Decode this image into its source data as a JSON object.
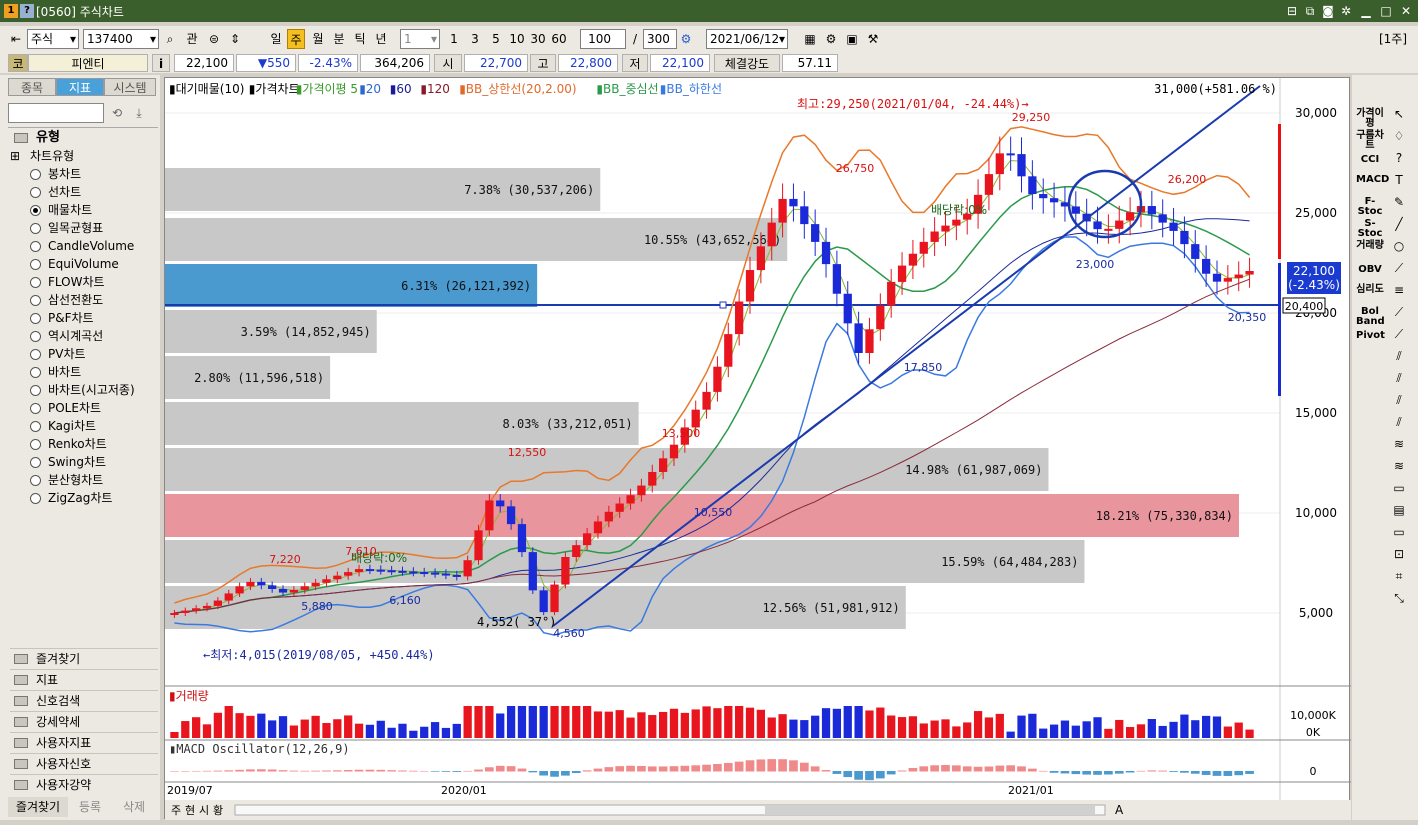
{
  "window": {
    "title": "[0560] 주식차트",
    "badge1": "1",
    "badge2": "?",
    "ctrl_icons": [
      "layout-icon",
      "copy-window-icon",
      "camera-icon",
      "settings-icon",
      "minimize-icon",
      "maximize-icon",
      "close-icon"
    ]
  },
  "toolbar": {
    "market": "주식",
    "code": "137400",
    "gwan": "관",
    "periods": [
      "일",
      "주",
      "월",
      "분",
      "틱",
      "년"
    ],
    "active_period": "주",
    "interval": "1",
    "quick": [
      "1",
      "3",
      "5",
      "10",
      "30",
      "60"
    ],
    "count": "100",
    "slash": "/",
    "total": "300",
    "date": "2021/06/12",
    "period_tag": "[1주]"
  },
  "info": {
    "cat": "코",
    "name": "피엔티",
    "i": "i",
    "price": "22,100",
    "change": "▼550",
    "rate": "-2.43%",
    "volume": "364,206",
    "open_label": "시",
    "open": "22,700",
    "high_label": "고",
    "high": "22,800",
    "low_label": "저",
    "low": "22,100",
    "strength_label": "체결강도",
    "strength": "57.11"
  },
  "sidebar": {
    "tabs": [
      "종목",
      "지표",
      "시스템"
    ],
    "active_tab": "지표",
    "section": "유형",
    "group": "차트유형",
    "types": [
      "봉차트",
      "선차트",
      "매물차트",
      "일목균형표",
      "CandleVolume",
      "EquiVolume",
      "FLOW차트",
      "삼선전환도",
      "P&F차트",
      "역시계곡선",
      "PV차트",
      "바차트",
      "바차트(시고저종)",
      "POLE차트",
      "Kagi차트",
      "Renko차트",
      "Swing차트",
      "분산형차트",
      "ZigZag차트"
    ],
    "selected_type": "매물차트",
    "accordion": [
      "즐겨찾기",
      "지표",
      "신호검색",
      "강세약세",
      "사용자지표",
      "사용자신호",
      "사용자강약"
    ],
    "bottom_tabs": [
      "즐겨찾기",
      "등록",
      "삭제"
    ]
  },
  "chart_legend": {
    "items": [
      "▮대기매물(10)",
      "▮가격차트",
      "▮가격이평 5",
      "▮20",
      "▮60",
      "▮120",
      "▮BB_상한선(20,2.00)",
      "▮BB_중심선",
      "▮BB_하한선"
    ],
    "colors": [
      "#000",
      "#000",
      "#3a9a2a",
      "#2a6ad0",
      "#1a1a9a",
      "#8a1a2a",
      "#e06a2a",
      "#2a9a4a",
      "#3a7ae0"
    ]
  },
  "annotations": {
    "high_note": "최고:29,250(2021/01/04, -24.44%)→",
    "low_note": "←최저:4,015(2019/08/05, +450.44%)",
    "top_right": "31,000(+581.06 %)",
    "div1": "배당락:0%",
    "div2": "배당락:0%",
    "trend_note": "4,552( 37°)"
  },
  "chart_data": {
    "type": "candlestick",
    "title": "",
    "x_ticks": [
      "2019/07",
      "2020/01",
      "2021/01"
    ],
    "y_ticks": [
      "30,000",
      "25,000",
      "20,000",
      "15,000",
      "10,000",
      "5,000"
    ],
    "ylim": [
      2500,
      32500
    ],
    "price_labels": [
      {
        "v": "29,250",
        "c": "#d81010"
      },
      {
        "v": "26,750",
        "c": "#d81010"
      },
      {
        "v": "26,200",
        "c": "#d81010"
      },
      {
        "v": "13,500",
        "c": "#d81010"
      },
      {
        "v": "12,550",
        "c": "#d81010"
      },
      {
        "v": "7,220",
        "c": "#d81010"
      },
      {
        "v": "7,610",
        "c": "#d81010"
      },
      {
        "v": "23,000",
        "c": "#1a2aa0"
      },
      {
        "v": "17,850",
        "c": "#1a2aa0"
      },
      {
        "v": "10,550",
        "c": "#1a2aa0"
      },
      {
        "v": "5,880",
        "c": "#1a2aa0"
      },
      {
        "v": "6,160",
        "c": "#1a2aa0"
      },
      {
        "v": "4,560",
        "c": "#1a2aa0"
      },
      {
        "v": "20,350",
        "c": "#1a2aa0"
      }
    ],
    "current_price": "22,100",
    "current_rate": "(-2.43%)",
    "hline_label": "20,400",
    "volume_profile": [
      {
        "label": "7.38% (30,537,206)",
        "pct": 7.38
      },
      {
        "label": "10.55% (43,652,564)",
        "pct": 10.55
      },
      {
        "label": "6.31% (26,121,392)",
        "pct": 6.31
      },
      {
        "label": "3.59% (14,852,945)",
        "pct": 3.59
      },
      {
        "label": "2.80% (11,596,518)",
        "pct": 2.8
      },
      {
        "label": "8.03% (33,212,051)",
        "pct": 8.03
      },
      {
        "label": "14.98% (61,987,069)",
        "pct": 14.98
      },
      {
        "label": "18.21% (75,330,834)",
        "pct": 18.21
      },
      {
        "label": "15.59% (64,484,283)",
        "pct": 15.59
      },
      {
        "label": "12.56% (51,981,912)",
        "pct": 12.56
      }
    ],
    "volume_title": "▮거래량",
    "volume_ticks": [
      "10,000K",
      "0K"
    ],
    "macd_title": "▮MACD Oscillator(12,26,9)",
    "macd_tick": "0"
  },
  "bottom": {
    "tabs": [
      "주",
      "현",
      "시",
      "황"
    ],
    "font_a": "A"
  },
  "right_tools": [
    "가격이평",
    "구름차트",
    "CCI",
    "MACD",
    "F-Stoc",
    "S-Stoc",
    "거래량",
    "OBV",
    "심리도",
    "Bol Band",
    "Pivot"
  ]
}
